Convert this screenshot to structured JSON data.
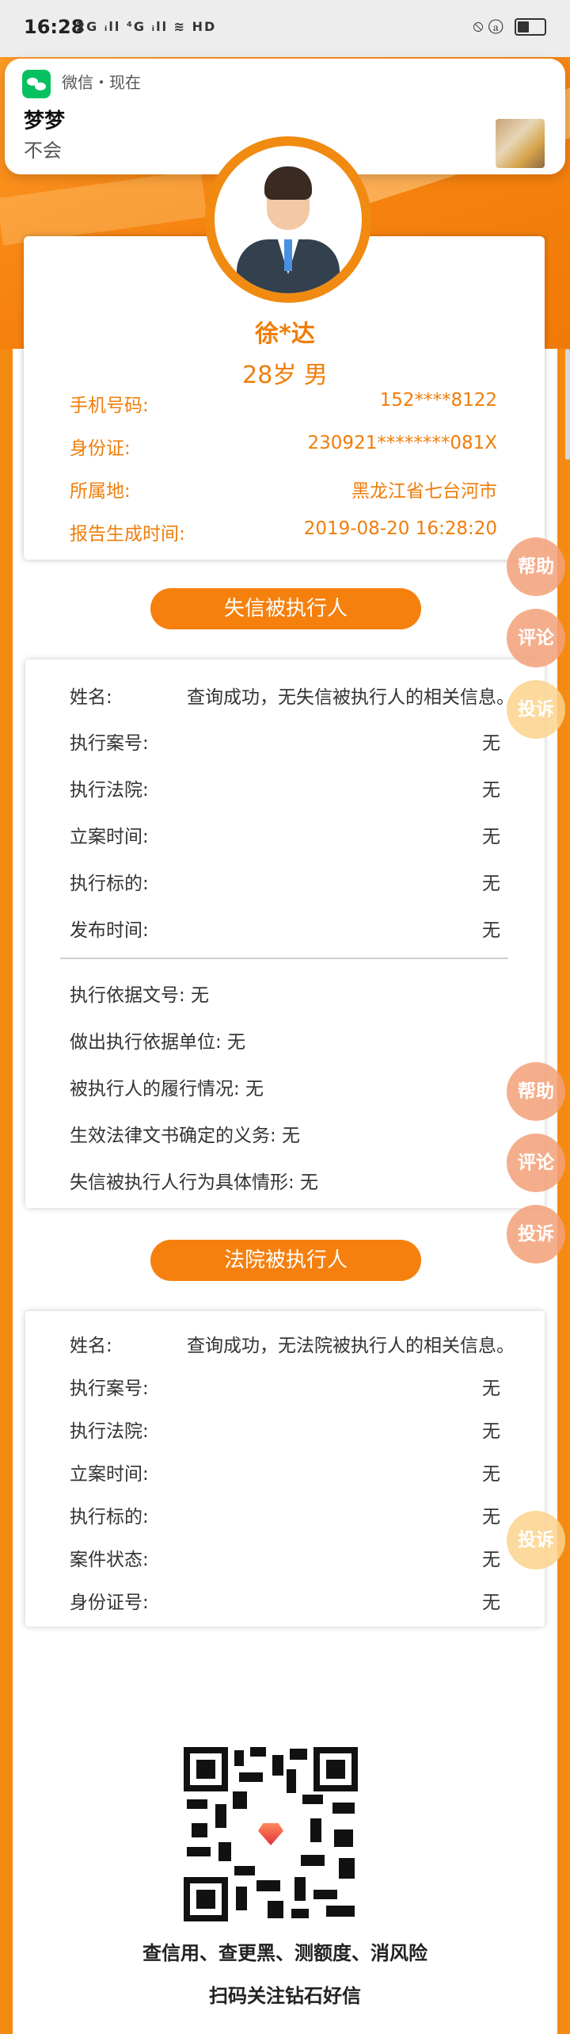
{
  "status_bar": {
    "time": "16:28",
    "network_icons": "2G ᵢll ⁴G ᵢll ≋ HD",
    "right_icons": "⦸ ⓐ"
  },
  "notification": {
    "app": "微信・现在",
    "title": "梦梦",
    "body": "不会"
  },
  "profile": {
    "name": "徐*达",
    "age_gender": "28岁 男",
    "rows": [
      {
        "label": "手机号码:",
        "value": "152****8122"
      },
      {
        "label": "身份证:",
        "value": "230921********081X"
      },
      {
        "label": "所属地:",
        "value": "黑龙江省七台河市"
      },
      {
        "label": "报告生成时间:",
        "value": "2019-08-20 16:28:20"
      }
    ]
  },
  "section1": {
    "title": "失信被执行人",
    "name_label": "姓名:",
    "name_value": "查询成功，无失信被执行人的相关信息。",
    "rows": [
      {
        "label": "执行案号:",
        "value": "无"
      },
      {
        "label": "执行法院:",
        "value": "无"
      },
      {
        "label": "立案时间:",
        "value": "无"
      },
      {
        "label": "执行标的:",
        "value": "无"
      },
      {
        "label": "发布时间:",
        "value": "无"
      }
    ],
    "extra": [
      "执行依据文号:  无",
      "做出执行依据单位:  无",
      "被执行人的履行情况:  无",
      "生效法律文书确定的义务:  无",
      "失信被执行人行为具体情形:  无"
    ]
  },
  "section2": {
    "title": "法院被执行人",
    "name_label": "姓名:",
    "name_value": "查询成功，无法院被执行人的相关信息。",
    "rows": [
      {
        "label": "执行案号:",
        "value": "无"
      },
      {
        "label": "执行法院:",
        "value": "无"
      },
      {
        "label": "立案时间:",
        "value": "无"
      },
      {
        "label": "执行标的:",
        "value": "无"
      },
      {
        "label": "案件状态:",
        "value": "无"
      },
      {
        "label": "身份证号:",
        "value": "无"
      }
    ]
  },
  "floating": {
    "help": "帮助",
    "comment": "评论",
    "complain": "投诉"
  },
  "footer": {
    "line1": "查信用、查更黑、测额度、消风险",
    "line2": "扫码关注钻石好信"
  }
}
